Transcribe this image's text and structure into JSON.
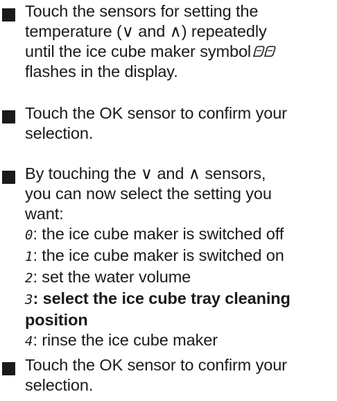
{
  "items": [
    {
      "lines": [
        "Touch the sensors for setting the",
        "temperature (∨ and ∧) repeatedly",
        "until the ice cube maker symbol",
        "flashes in the display."
      ],
      "icon": "ice-cube-maker-icon"
    },
    {
      "lines": [
        "Touch the OK sensor to confirm your",
        "selection."
      ]
    },
    {
      "lines": [
        "By touching the ∨ and ∧ sensors,",
        "you can now select the setting you",
        "want:"
      ],
      "options": [
        {
          "digit": "0",
          "text": ": the ice cube maker is switched off"
        },
        {
          "digit": "1",
          "text": ": the ice cube maker is switched on"
        },
        {
          "digit": "2",
          "text": ": set the water volume"
        },
        {
          "digit": "3",
          "text": ": select the ice cube tray cleaning",
          "text2": "position"
        },
        {
          "digit": "4",
          "text": ": rinse the ice cube maker"
        }
      ]
    },
    {
      "lines": [
        "Touch the OK sensor to confirm your",
        "selection."
      ]
    }
  ]
}
